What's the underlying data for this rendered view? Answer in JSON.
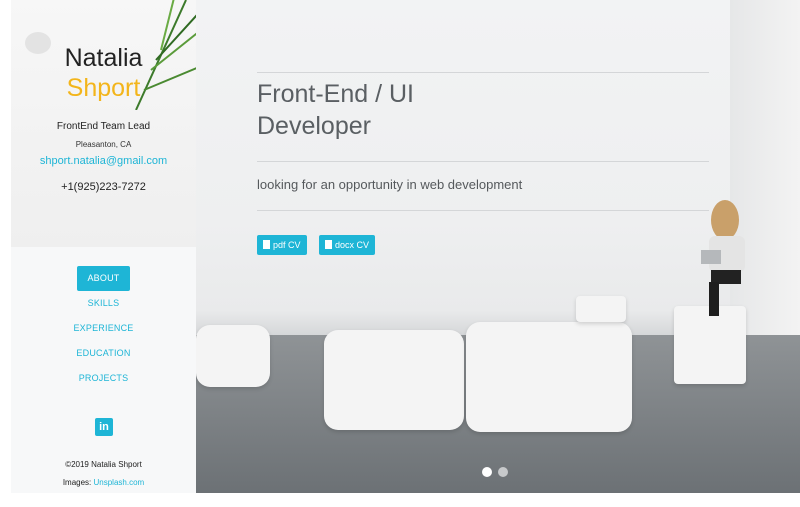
{
  "profile": {
    "first_name": "Natalia",
    "last_name": "Shport",
    "job_title": "FrontEnd Team Lead",
    "location": "Pleasanton, CA",
    "email": "shport.natalia@gmail.com",
    "phone": "+1(925)223-7272"
  },
  "nav": {
    "items": [
      {
        "label": "ABOUT",
        "active": true
      },
      {
        "label": "SKILLS",
        "active": false
      },
      {
        "label": "EXPERIENCE",
        "active": false
      },
      {
        "label": "EDUCATION",
        "active": false
      },
      {
        "label": "PROJECTS",
        "active": false
      }
    ]
  },
  "social": {
    "linkedin_icon": "in"
  },
  "footer": {
    "copyright": "©2019 Natalia Shport",
    "images_prefix": "Images: ",
    "images_link": "Unsplash.com"
  },
  "hero": {
    "title_line1": "Front-End / UI",
    "title_line2": "Developer",
    "subtitle": "looking for an opportunity in web development",
    "pdf_button": "pdf CV",
    "docx_button": "docx CV",
    "slides": [
      {
        "active": true
      },
      {
        "active": false
      }
    ]
  },
  "colors": {
    "accent": "#1eb5d6",
    "name_highlight": "#f3b51b",
    "text_dark": "#222222",
    "hero_text": "#5a5f63"
  }
}
